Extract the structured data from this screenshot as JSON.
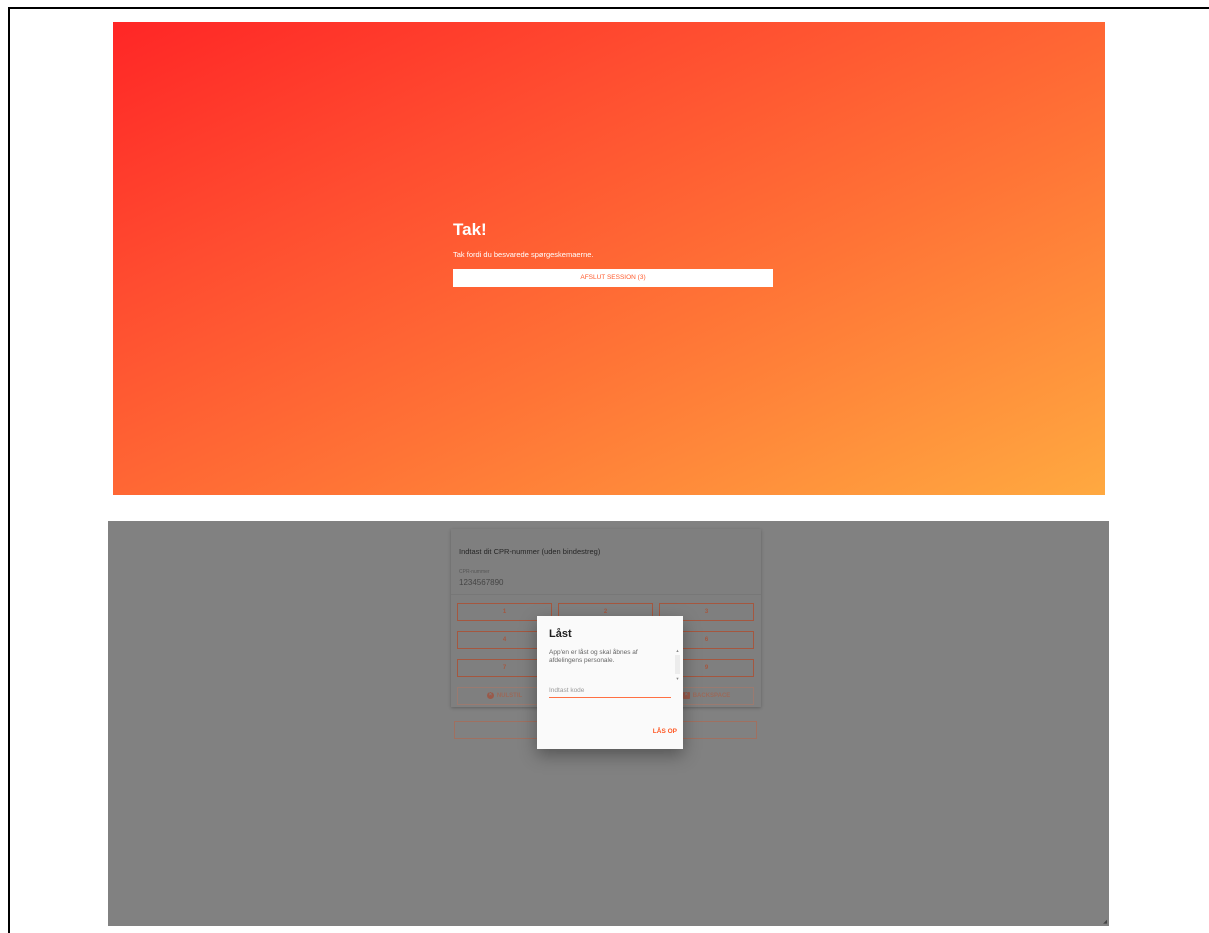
{
  "thanks_screen": {
    "title": "Tak!",
    "message": "Tak fordi du besvarede spørgeskemaerne.",
    "end_session_button": "AFSLUT SESSION (3)"
  },
  "cpr_screen": {
    "title": "Indtast dit CPR-nummer (uden bindestreg)",
    "field_label": "CPR-nummer",
    "field_value": "1234567890",
    "keypad": [
      "1",
      "2",
      "3",
      "4",
      "5",
      "6",
      "7",
      "8",
      "9"
    ],
    "reset_label": "NULSTIL",
    "backspace_label": "BACKSPACE"
  },
  "lock_dialog": {
    "title": "Låst",
    "message": "App'en er låst og skal åbnes af afdelingens personale.",
    "code_placeholder": "Indtast kode",
    "unlock_button": "LÅS OP"
  },
  "colors": {
    "gradient_start": "#ff2626",
    "gradient_end": "#ffa940",
    "accent": "#ff5722",
    "overlay_gray": "#818181"
  }
}
